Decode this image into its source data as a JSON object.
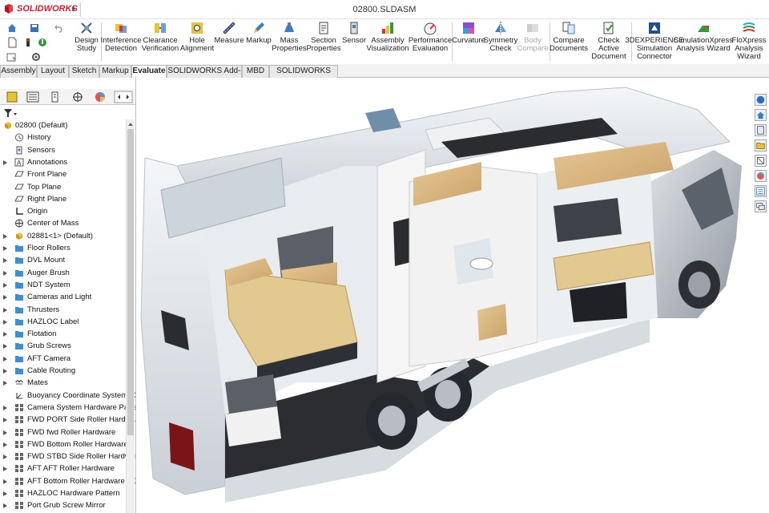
{
  "app": {
    "brand": "SOLIDWORKS",
    "doc_title": "02800.SLDASM",
    "accent": "#d3202f"
  },
  "ribbon": {
    "buttons": [
      {
        "id": "design-study",
        "label": "Design Study",
        "icon": "design-study-icon"
      },
      {
        "id": "interference-detection",
        "label": "Interference Detection",
        "icon": "interference-icon"
      },
      {
        "id": "clearance-verification",
        "label": "Clearance Verification",
        "icon": "clearance-icon"
      },
      {
        "id": "hole-alignment",
        "label": "Hole Alignment",
        "icon": "hole-alignment-icon"
      },
      {
        "id": "measure",
        "label": "Measure",
        "icon": "measure-icon"
      },
      {
        "id": "markup",
        "label": "Markup",
        "icon": "markup-icon"
      },
      {
        "id": "mass-properties",
        "label": "Mass Properties",
        "icon": "mass-properties-icon"
      },
      {
        "id": "section-properties",
        "label": "Section Properties",
        "icon": "section-properties-icon"
      },
      {
        "id": "sensor",
        "label": "Sensor",
        "icon": "sensor-icon"
      },
      {
        "id": "assembly-visualization",
        "label": "Assembly Visualization",
        "icon": "assembly-visualization-icon"
      },
      {
        "id": "performance-evaluation",
        "label": "Performance Evaluation",
        "icon": "performance-icon"
      },
      {
        "id": "curvature",
        "label": "Curvature",
        "icon": "curvature-icon"
      },
      {
        "id": "symmetry-check",
        "label": "Symmetry Check",
        "icon": "symmetry-icon"
      },
      {
        "id": "body-compare",
        "label": "Body Compare",
        "icon": "body-compare-icon",
        "disabled": true
      },
      {
        "id": "compare-documents",
        "label": "Compare Documents",
        "icon": "compare-documents-icon"
      },
      {
        "id": "check-active-document",
        "label": "Check Active Document",
        "icon": "check-active-icon"
      },
      {
        "id": "3dexperience-simulation",
        "label": "3DEXPERIENCE Simulation Connector",
        "icon": "3dexperience-icon"
      },
      {
        "id": "simulationxpress",
        "label": "SimulationXpress Analysis Wizard",
        "icon": "simulationxpress-icon"
      },
      {
        "id": "floxpress",
        "label": "FloXpress Analysis Wizard",
        "icon": "floxpress-icon"
      }
    ]
  },
  "tabs": [
    {
      "label": "Assembly"
    },
    {
      "label": "Layout"
    },
    {
      "label": "Sketch"
    },
    {
      "label": "Markup"
    },
    {
      "label": "Evaluate",
      "active": true
    },
    {
      "label": "SOLIDWORKS Add-Ins"
    },
    {
      "label": "MBD"
    },
    {
      "label": "SOLIDWORKS CAM"
    }
  ],
  "tree": {
    "root": "02800  (Default)",
    "items": [
      {
        "label": "History",
        "icon": "history-icon",
        "expandable": false
      },
      {
        "label": "Sensors",
        "icon": "sensors-icon",
        "expandable": false
      },
      {
        "label": "Annotations",
        "icon": "annotations-icon",
        "expandable": true
      },
      {
        "label": "Front Plane",
        "icon": "plane-icon",
        "expandable": false
      },
      {
        "label": "Top Plane",
        "icon": "plane-icon",
        "expandable": false
      },
      {
        "label": "Right Plane",
        "icon": "plane-icon",
        "expandable": false
      },
      {
        "label": "Origin",
        "icon": "origin-icon",
        "expandable": false
      },
      {
        "label": "Center of Mass",
        "icon": "center-of-mass-icon",
        "expandable": false
      },
      {
        "label": "02881<1> (Default)",
        "icon": "part-icon",
        "expandable": true
      },
      {
        "label": "Floor Rollers",
        "icon": "folder-icon",
        "expandable": true
      },
      {
        "label": "DVL Mount",
        "icon": "folder-icon",
        "expandable": true
      },
      {
        "label": "Auger Brush",
        "icon": "folder-icon",
        "expandable": true
      },
      {
        "label": "NDT System",
        "icon": "folder-icon",
        "expandable": true
      },
      {
        "label": "Cameras and Light",
        "icon": "folder-icon",
        "expandable": true
      },
      {
        "label": "Thrusters",
        "icon": "folder-icon",
        "expandable": true
      },
      {
        "label": "HAZLOC Label",
        "icon": "folder-icon",
        "expandable": true
      },
      {
        "label": "Flotation",
        "icon": "folder-icon",
        "expandable": true
      },
      {
        "label": "Grub Screws",
        "icon": "folder-icon",
        "expandable": true
      },
      {
        "label": "AFT Camera",
        "icon": "folder-icon",
        "expandable": true
      },
      {
        "label": "Cable Routing",
        "icon": "folder-icon",
        "expandable": true
      },
      {
        "label": "Mates",
        "icon": "mates-icon",
        "expandable": true
      },
      {
        "label": "Buoyancy Coordinate System +X",
        "icon": "coordinate-system-icon",
        "expandable": false
      },
      {
        "label": "Camera System Hardware Pattern",
        "icon": "pattern-icon",
        "expandable": true
      },
      {
        "label": "FWD PORT Side Roller Hardware",
        "icon": "pattern-icon",
        "expandable": true
      },
      {
        "label": "FWD fwd Roller Hardware",
        "icon": "pattern-icon",
        "expandable": true
      },
      {
        "label": "FWD Bottom Roller Hardware",
        "icon": "pattern-icon",
        "expandable": true
      },
      {
        "label": "FWD STBD Side Roller Hardware",
        "icon": "pattern-icon",
        "expandable": true
      },
      {
        "label": "AFT AFT Roller Hardware",
        "icon": "pattern-icon",
        "expandable": true
      },
      {
        "label": "AFT Bottom Roller Hardware HD",
        "icon": "pattern-icon",
        "expandable": true
      },
      {
        "label": "HAZLOC Hardware Pattern",
        "icon": "pattern-icon",
        "expandable": true
      },
      {
        "label": "Port Grub Screw Mirror",
        "icon": "pattern-icon",
        "expandable": true
      }
    ]
  },
  "viewport": {
    "model_description_icon": "motorhome-cutaway-model"
  }
}
